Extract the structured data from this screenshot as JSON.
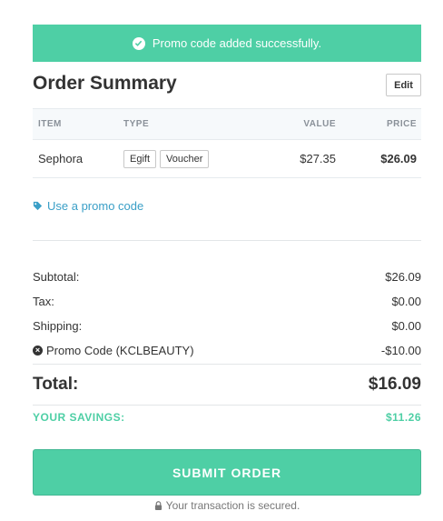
{
  "banner": {
    "message": "Promo code added successfully."
  },
  "summary": {
    "title": "Order Summary",
    "edit_label": "Edit",
    "columns": {
      "item": "ITEM",
      "type": "TYPE",
      "value": "VALUE",
      "price": "PRICE"
    },
    "items": [
      {
        "item": "Sephora",
        "tags": [
          "Egift",
          "Voucher"
        ],
        "value": "$27.35",
        "price": "$26.09"
      }
    ],
    "promo_link": "Use a promo code"
  },
  "totals": {
    "subtotal_label": "Subtotal:",
    "subtotal": "$26.09",
    "tax_label": "Tax:",
    "tax": "$0.00",
    "shipping_label": "Shipping:",
    "shipping": "$0.00",
    "promo_label": "Promo Code (KCLBEAUTY)",
    "promo": "-$10.00",
    "total_label": "Total:",
    "total": "$16.09",
    "savings_label": "YOUR SAVINGS:",
    "savings": "$11.26"
  },
  "submit_label": "SUBMIT ORDER",
  "secure_note": "Your transaction is secured.",
  "colors": {
    "accent": "#4ecfa5",
    "link": "#3a9fc7"
  },
  "icons": {
    "banner": "check-circle-icon",
    "promo": "tag-icon",
    "remove": "close-circle-icon",
    "secure": "lock-icon"
  }
}
